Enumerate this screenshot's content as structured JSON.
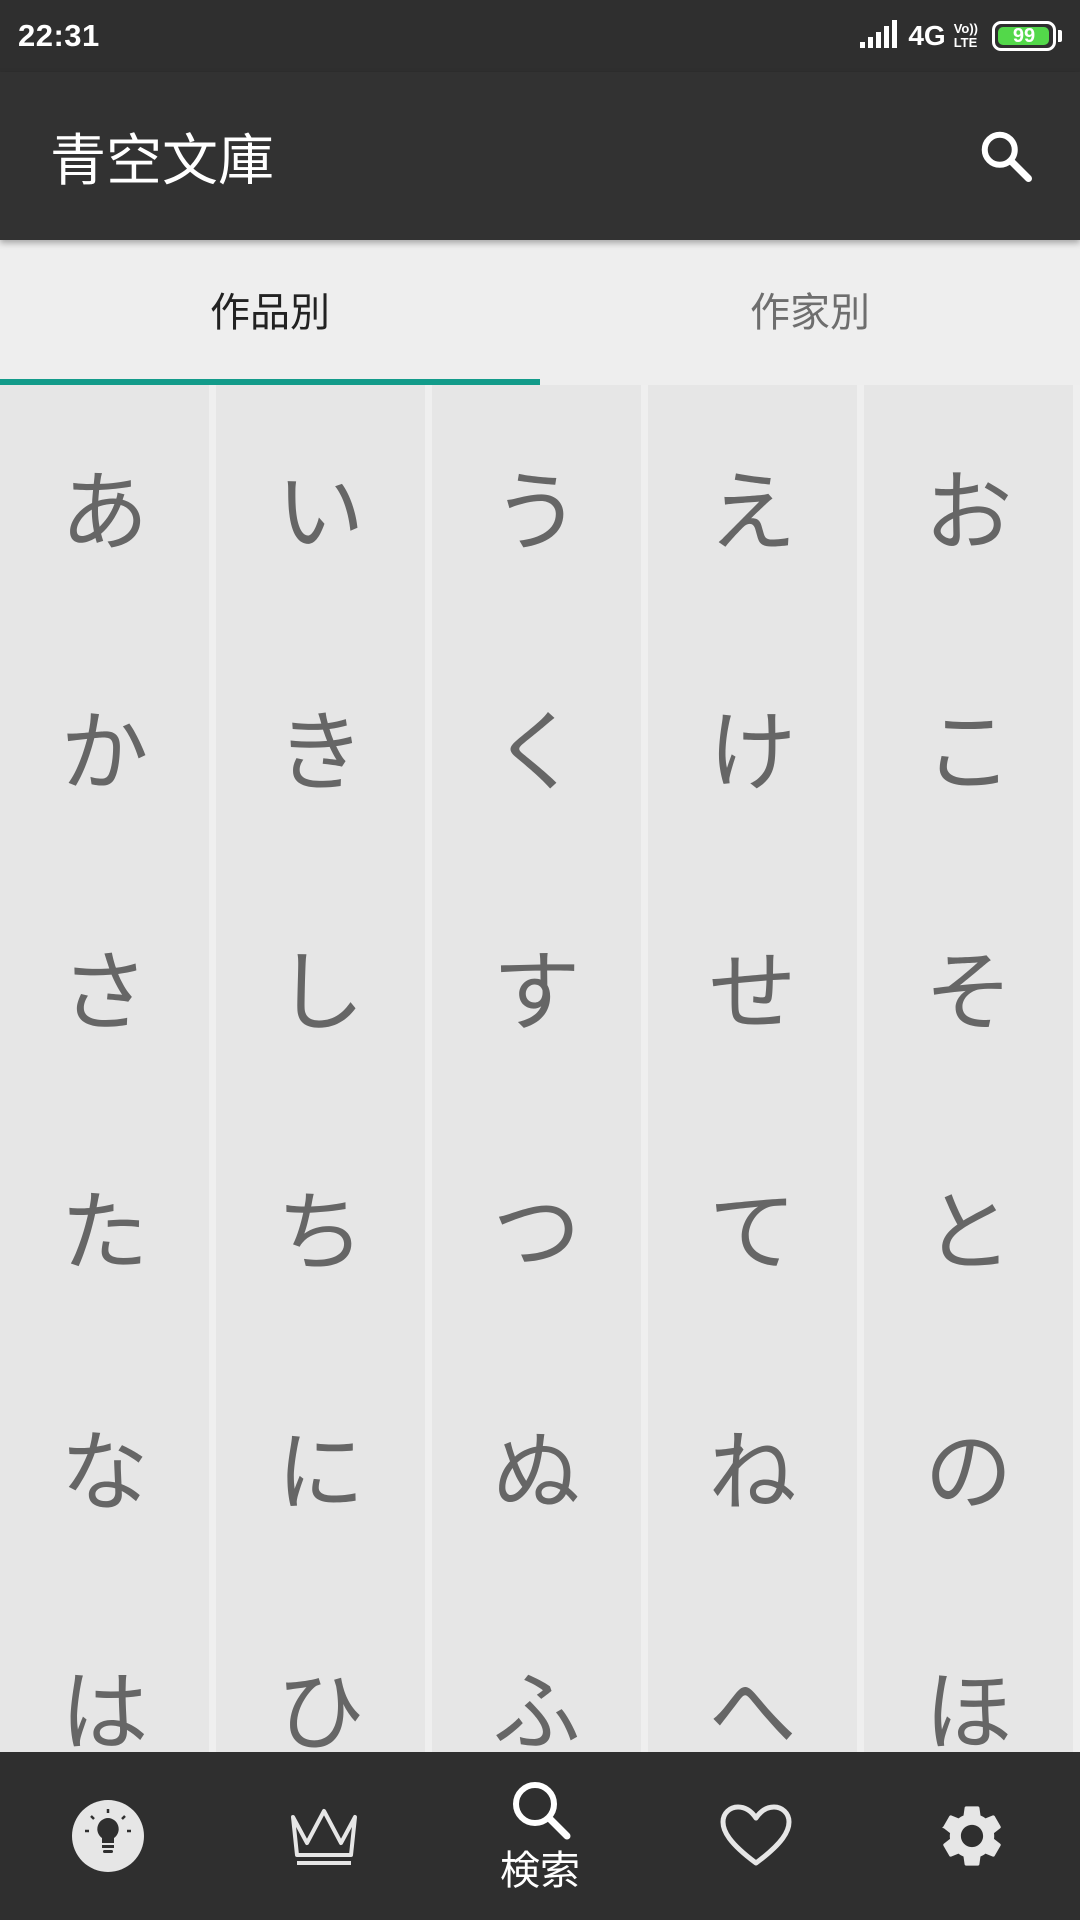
{
  "status_bar": {
    "time": "22:31",
    "network": "4G",
    "volte_top": "Vo))",
    "volte_bottom": "LTE",
    "battery_level": 99,
    "battery_text": "99",
    "battery_color": "#53d84a"
  },
  "app_bar": {
    "title": "青空文庫",
    "search_icon": "search-icon"
  },
  "tabs": [
    {
      "label": "作品別",
      "active": true
    },
    {
      "label": "作家別",
      "active": false
    }
  ],
  "accent_color": "#129b8a",
  "kana_grid": {
    "columns": [
      [
        "あ",
        "か",
        "さ",
        "た",
        "な",
        "は"
      ],
      [
        "い",
        "き",
        "し",
        "ち",
        "に",
        "ひ"
      ],
      [
        "う",
        "く",
        "す",
        "つ",
        "ぬ",
        "ふ"
      ],
      [
        "え",
        "け",
        "せ",
        "て",
        "ね",
        "へ"
      ],
      [
        "お",
        "こ",
        "そ",
        "と",
        "の",
        "ほ"
      ]
    ]
  },
  "bottom_nav": {
    "items": [
      {
        "icon": "lightbulb-icon",
        "label": ""
      },
      {
        "icon": "crown-icon",
        "label": ""
      },
      {
        "icon": "search-icon",
        "label": "検索",
        "active": true
      },
      {
        "icon": "heart-icon",
        "label": ""
      },
      {
        "icon": "gear-icon",
        "label": ""
      }
    ]
  }
}
